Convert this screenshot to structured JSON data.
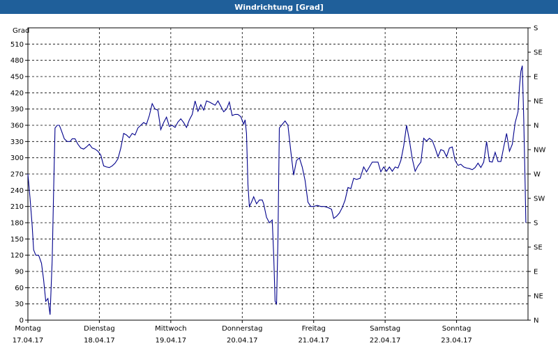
{
  "window": {
    "title": "Windrichtung [Grad]"
  },
  "chart_data": {
    "type": "line",
    "title": "Windrichtung [Grad]",
    "ylabel": "Grad",
    "ylim": [
      0,
      540
    ],
    "y_ticks": [
      0,
      30,
      60,
      90,
      120,
      150,
      180,
      210,
      240,
      270,
      300,
      330,
      360,
      390,
      420,
      450,
      480,
      510
    ],
    "right_ticks": [
      {
        "v": 0,
        "label": "N"
      },
      {
        "v": 45,
        "label": "NE"
      },
      {
        "v": 90,
        "label": "E"
      },
      {
        "v": 135,
        "label": "SE"
      },
      {
        "v": 180,
        "label": "S"
      },
      {
        "v": 225,
        "label": "SW"
      },
      {
        "v": 270,
        "label": "W"
      },
      {
        "v": 315,
        "label": "NW"
      },
      {
        "v": 360,
        "label": "N"
      },
      {
        "v": 405,
        "label": "NE"
      },
      {
        "v": 450,
        "label": "E"
      },
      {
        "v": 495,
        "label": "SE"
      },
      {
        "v": 540,
        "label": "S"
      }
    ],
    "xlim": [
      0,
      7
    ],
    "x_ticks": [
      {
        "v": 0,
        "day": "Montag",
        "date": "17.04.17"
      },
      {
        "v": 1,
        "day": "Dienstag",
        "date": "18.04.17"
      },
      {
        "v": 2,
        "day": "Mittwoch",
        "date": "19.04.17"
      },
      {
        "v": 3,
        "day": "Donnerstag",
        "date": "20.04.17"
      },
      {
        "v": 4,
        "day": "Freitag",
        "date": "21.04.17"
      },
      {
        "v": 5,
        "day": "Samstag",
        "date": "22.04.17"
      },
      {
        "v": 6,
        "day": "Sonntag",
        "date": "23.04.17"
      }
    ],
    "grid": true,
    "line_color": "#00008b",
    "series": [
      {
        "points": [
          [
            0.0,
            270
          ],
          [
            0.03,
            225
          ],
          [
            0.06,
            175
          ],
          [
            0.08,
            130
          ],
          [
            0.11,
            120
          ],
          [
            0.15,
            120
          ],
          [
            0.19,
            105
          ],
          [
            0.22,
            75
          ],
          [
            0.25,
            35
          ],
          [
            0.28,
            40
          ],
          [
            0.31,
            10
          ],
          [
            0.34,
            110
          ],
          [
            0.36,
            240
          ],
          [
            0.38,
            355
          ],
          [
            0.41,
            360
          ],
          [
            0.44,
            360
          ],
          [
            0.47,
            350
          ],
          [
            0.51,
            335
          ],
          [
            0.55,
            330
          ],
          [
            0.59,
            330
          ],
          [
            0.62,
            335
          ],
          [
            0.66,
            335
          ],
          [
            0.7,
            325
          ],
          [
            0.74,
            318
          ],
          [
            0.78,
            316
          ],
          [
            0.82,
            320
          ],
          [
            0.86,
            325
          ],
          [
            0.9,
            318
          ],
          [
            0.94,
            316
          ],
          [
            0.98,
            312
          ],
          [
            1.02,
            305
          ],
          [
            1.06,
            285
          ],
          [
            1.1,
            283
          ],
          [
            1.14,
            282
          ],
          [
            1.18,
            285
          ],
          [
            1.22,
            290
          ],
          [
            1.26,
            298
          ],
          [
            1.3,
            318
          ],
          [
            1.34,
            345
          ],
          [
            1.38,
            342
          ],
          [
            1.42,
            337
          ],
          [
            1.46,
            345
          ],
          [
            1.5,
            342
          ],
          [
            1.54,
            355
          ],
          [
            1.58,
            360
          ],
          [
            1.62,
            365
          ],
          [
            1.66,
            362
          ],
          [
            1.7,
            378
          ],
          [
            1.74,
            400
          ],
          [
            1.78,
            390
          ],
          [
            1.82,
            388
          ],
          [
            1.86,
            352
          ],
          [
            1.9,
            365
          ],
          [
            1.94,
            375
          ],
          [
            1.98,
            358
          ],
          [
            2.02,
            360
          ],
          [
            2.06,
            356
          ],
          [
            2.1,
            366
          ],
          [
            2.14,
            372
          ],
          [
            2.18,
            365
          ],
          [
            2.22,
            356
          ],
          [
            2.26,
            370
          ],
          [
            2.3,
            380
          ],
          [
            2.34,
            405
          ],
          [
            2.38,
            386
          ],
          [
            2.42,
            398
          ],
          [
            2.46,
            388
          ],
          [
            2.5,
            405
          ],
          [
            2.54,
            403
          ],
          [
            2.58,
            400
          ],
          [
            2.62,
            397
          ],
          [
            2.66,
            405
          ],
          [
            2.7,
            395
          ],
          [
            2.74,
            385
          ],
          [
            2.78,
            390
          ],
          [
            2.82,
            403
          ],
          [
            2.86,
            378
          ],
          [
            2.9,
            380
          ],
          [
            2.94,
            380
          ],
          [
            2.98,
            376
          ],
          [
            3.02,
            362
          ],
          [
            3.04,
            370
          ],
          [
            3.06,
            345
          ],
          [
            3.08,
            250
          ],
          [
            3.1,
            210
          ],
          [
            3.13,
            218
          ],
          [
            3.16,
            228
          ],
          [
            3.2,
            215
          ],
          [
            3.24,
            222
          ],
          [
            3.28,
            222
          ],
          [
            3.3,
            215
          ],
          [
            3.34,
            190
          ],
          [
            3.38,
            180
          ],
          [
            3.42,
            185
          ],
          [
            3.44,
            120
          ],
          [
            3.46,
            35
          ],
          [
            3.48,
            30
          ],
          [
            3.5,
            150
          ],
          [
            3.52,
            355
          ],
          [
            3.55,
            360
          ],
          [
            3.6,
            368
          ],
          [
            3.64,
            360
          ],
          [
            3.68,
            312
          ],
          [
            3.72,
            268
          ],
          [
            3.76,
            295
          ],
          [
            3.8,
            300
          ],
          [
            3.84,
            283
          ],
          [
            3.88,
            258
          ],
          [
            3.92,
            218
          ],
          [
            3.96,
            210
          ],
          [
            4.0,
            210
          ],
          [
            4.05,
            212
          ],
          [
            4.1,
            210
          ],
          [
            4.15,
            210
          ],
          [
            4.2,
            208
          ],
          [
            4.25,
            205
          ],
          [
            4.28,
            188
          ],
          [
            4.32,
            192
          ],
          [
            4.36,
            198
          ],
          [
            4.4,
            208
          ],
          [
            4.44,
            222
          ],
          [
            4.48,
            245
          ],
          [
            4.52,
            243
          ],
          [
            4.56,
            262
          ],
          [
            4.6,
            260
          ],
          [
            4.65,
            262
          ],
          [
            4.7,
            283
          ],
          [
            4.74,
            274
          ],
          [
            4.78,
            283
          ],
          [
            4.82,
            292
          ],
          [
            4.86,
            292
          ],
          [
            4.9,
            292
          ],
          [
            4.94,
            274
          ],
          [
            4.98,
            283
          ],
          [
            5.02,
            275
          ],
          [
            5.06,
            283
          ],
          [
            5.1,
            275
          ],
          [
            5.14,
            283
          ],
          [
            5.18,
            281
          ],
          [
            5.22,
            295
          ],
          [
            5.26,
            322
          ],
          [
            5.3,
            360
          ],
          [
            5.34,
            332
          ],
          [
            5.38,
            298
          ],
          [
            5.42,
            275
          ],
          [
            5.46,
            285
          ],
          [
            5.5,
            292
          ],
          [
            5.54,
            336
          ],
          [
            5.58,
            331
          ],
          [
            5.62,
            336
          ],
          [
            5.66,
            332
          ],
          [
            5.7,
            318
          ],
          [
            5.74,
            302
          ],
          [
            5.78,
            315
          ],
          [
            5.82,
            313
          ],
          [
            5.86,
            302
          ],
          [
            5.9,
            318
          ],
          [
            5.94,
            320
          ],
          [
            5.98,
            295
          ],
          [
            6.02,
            286
          ],
          [
            6.06,
            288
          ],
          [
            6.1,
            283
          ],
          [
            6.14,
            281
          ],
          [
            6.18,
            280
          ],
          [
            6.22,
            278
          ],
          [
            6.26,
            282
          ],
          [
            6.3,
            290
          ],
          [
            6.34,
            282
          ],
          [
            6.38,
            292
          ],
          [
            6.42,
            330
          ],
          [
            6.46,
            293
          ],
          [
            6.5,
            292
          ],
          [
            6.54,
            310
          ],
          [
            6.58,
            293
          ],
          [
            6.62,
            293
          ],
          [
            6.66,
            320
          ],
          [
            6.7,
            345
          ],
          [
            6.74,
            312
          ],
          [
            6.78,
            325
          ],
          [
            6.82,
            365
          ],
          [
            6.86,
            385
          ],
          [
            6.88,
            430
          ],
          [
            6.9,
            460
          ],
          [
            6.92,
            470
          ],
          [
            6.94,
            370
          ],
          [
            6.96,
            250
          ],
          [
            6.97,
            180
          ]
        ]
      }
    ]
  }
}
